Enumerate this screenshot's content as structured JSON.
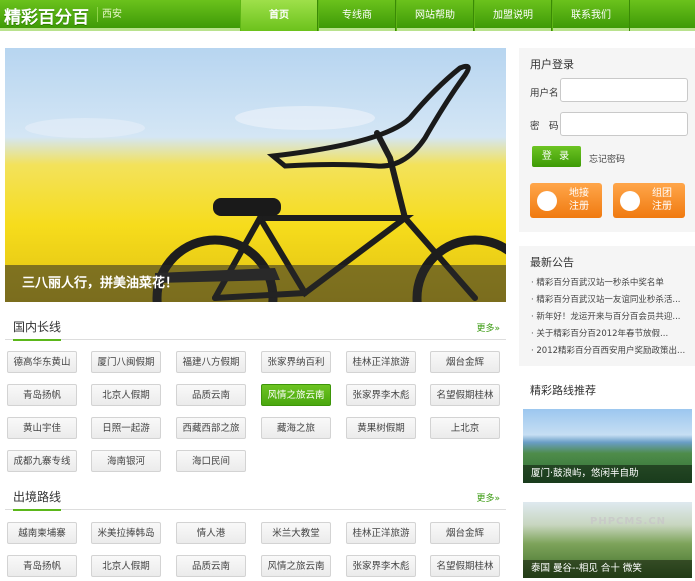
{
  "header": {
    "logo": "精彩百分百",
    "city": "西安",
    "nav": [
      "首页",
      "专线商",
      "网站帮助",
      "加盟说明",
      "联系我们"
    ]
  },
  "banner": {
    "caption": "三八丽人行，拼美油菜花！"
  },
  "domestic": {
    "title": "国内长线",
    "more": "更多»",
    "routes": [
      "德高华东黄山",
      "厦门八闽假期",
      "福建八方假期",
      "张家界纳百利",
      "桂林正洋旅游",
      "烟台金辉",
      "青岛扬帆",
      "北京人假期",
      "品质云南",
      "风情之旅云南",
      "张家界李木彪",
      "名望假期桂林",
      "黄山宇佳",
      "日照一起游",
      "西藏西部之旅",
      "藏海之旅",
      "黄果树假期",
      "上北京",
      "成都九寨专线",
      "海南银河",
      "海口民间"
    ],
    "active_index": 9
  },
  "overseas": {
    "title": "出境路线",
    "more": "更多»",
    "routes": [
      "越南柬埔寨",
      "米美拉捧韩岛",
      "情人港",
      "米兰大教堂",
      "桂林正洋旅游",
      "烟台金辉",
      "青岛扬帆",
      "北京人假期",
      "品质云南",
      "风情之旅云南",
      "张家界李木彪",
      "名望假期桂林"
    ]
  },
  "login": {
    "title": "用户登录",
    "username_label": "用户名",
    "password_label": "密　码",
    "login_button": "登 录",
    "forgot": "忘记密码",
    "register_agent": "地接\n注册",
    "register_group": "组团\n注册"
  },
  "notices": {
    "title": "最新公告",
    "items": [
      "· 精彩百分百武汉站一秒杀中奖名单",
      "· 精彩百分百武汉站一友谊同业秒杀活...",
      "· 新年好！龙运开来与百分百会员共迎...",
      "· 关于精彩百分百2012年春节放假...",
      "· 2012精彩百分百西安用户奖励政策出..."
    ]
  },
  "recommend": {
    "title": "精彩路线推荐",
    "items": [
      "厦门·鼓浪屿，悠闲半自助",
      "泰国 曼谷--相见 合十 微笑"
    ]
  },
  "watermark": "PHPCMS.CN",
  "colors": {
    "brand_green": "#4aa70f",
    "accent_orange": "#f07a10"
  }
}
